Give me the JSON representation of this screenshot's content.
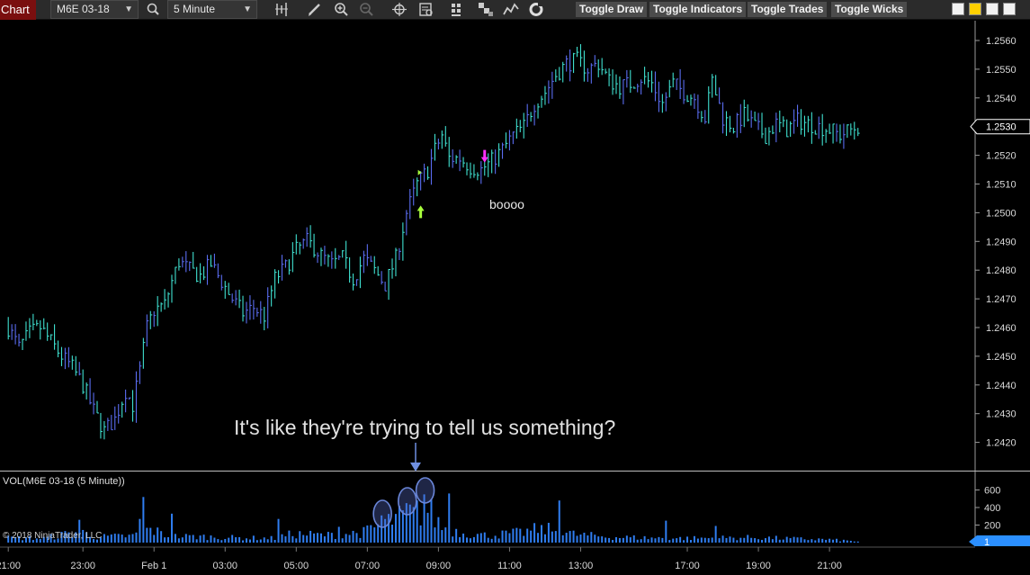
{
  "toolbar": {
    "chart_tab": "Chart",
    "instrument": "M6E 03-18",
    "interval": "5 Minute",
    "buttons": [
      "Toggle Draw",
      "Toggle Indicators",
      "Toggle Trades",
      "Toggle Wicks"
    ],
    "icons": [
      "magnifier-icon",
      "bar-type-icon",
      "pencil-icon",
      "zoom-in-icon",
      "zoom-out-icon",
      "crosshair-icon",
      "data-box-icon",
      "indicators-icon",
      "strategies-icon",
      "templates-icon",
      "refresh-icon"
    ]
  },
  "swatch_colors": [
    "#f2f2f2",
    "#ffd000",
    "#f2f2f2",
    "#f2f2f2"
  ],
  "annotations": {
    "boooo": "boooo",
    "message": "It's like they're trying to tell us something?"
  },
  "volume_panel": {
    "label": "VOL(M6E 03-18 (5 Minute))",
    "current_volume": "1",
    "copyright": "© 2018 NinjaTrader, LLC"
  },
  "colors": {
    "background": "#000000",
    "candle_primary": "#3fe0d0",
    "candle_secondary": "#5a6cf0",
    "volume": "#2f7df0",
    "price_marker": "#ffffff",
    "volume_marker": "#2b8fff",
    "up_arrow": "#a8ff3c",
    "down_arrow": "#ff2fff",
    "annotation_ellipse": "#6a86d8"
  },
  "chart_data": {
    "type": "candlestick",
    "price_axis": {
      "ticks": [
        "1.2420",
        "1.2430",
        "1.2440",
        "1.2450",
        "1.2460",
        "1.2470",
        "1.2480",
        "1.2490",
        "1.2500",
        "1.2510",
        "1.2520",
        "1.2530",
        "1.2540",
        "1.2550",
        "1.2560"
      ],
      "ylim": [
        1.24161,
        1.25631
      ],
      "last_price": "1.2530"
    },
    "volume_axis": {
      "ticks": [
        "200",
        "400",
        "600"
      ],
      "ylim": [
        0,
        800
      ]
    },
    "time_axis": {
      "ticks": [
        "21:00",
        "23:00",
        "Feb 1",
        "03:00",
        "05:00",
        "07:00",
        "09:00",
        "11:00",
        "13:00",
        "17:00",
        "19:00",
        "21:00"
      ],
      "tick_bar_index": [
        0,
        21,
        41,
        61,
        81,
        101,
        121,
        141,
        161,
        191,
        211,
        231
      ]
    },
    "price_path": [
      [
        0,
        1.246
      ],
      [
        3,
        1.2453
      ],
      [
        6,
        1.2458
      ],
      [
        9,
        1.246
      ],
      [
        12,
        1.2455
      ],
      [
        15,
        1.245
      ],
      [
        18,
        1.2446
      ],
      [
        21,
        1.244
      ],
      [
        24,
        1.2431
      ],
      [
        27,
        1.2424
      ],
      [
        30,
        1.2428
      ],
      [
        33,
        1.2438
      ],
      [
        35,
        1.2433
      ],
      [
        37,
        1.2445
      ],
      [
        39,
        1.246
      ],
      [
        41,
        1.2466
      ],
      [
        44,
        1.2468
      ],
      [
        46,
        1.2476
      ],
      [
        48,
        1.2483
      ],
      [
        51,
        1.248
      ],
      [
        54,
        1.2478
      ],
      [
        57,
        1.2482
      ],
      [
        60,
        1.2476
      ],
      [
        63,
        1.247
      ],
      [
        66,
        1.2465
      ],
      [
        69,
        1.2467
      ],
      [
        72,
        1.2464
      ],
      [
        75,
        1.2477
      ],
      [
        78,
        1.2481
      ],
      [
        81,
        1.2487
      ],
      [
        84,
        1.249
      ],
      [
        86,
        1.2488
      ],
      [
        88,
        1.2485
      ],
      [
        91,
        1.2482
      ],
      [
        94,
        1.2484
      ],
      [
        97,
        1.2477
      ],
      [
        100,
        1.2484
      ],
      [
        103,
        1.248
      ],
      [
        106,
        1.2475
      ],
      [
        109,
        1.2484
      ],
      [
        112,
        1.25
      ],
      [
        115,
        1.251
      ],
      [
        118,
        1.2515
      ],
      [
        120,
        1.2522
      ],
      [
        122,
        1.2527
      ],
      [
        124,
        1.2519
      ],
      [
        127,
        1.2519
      ],
      [
        130,
        1.2516
      ],
      [
        133,
        1.2515
      ],
      [
        136,
        1.2518
      ],
      [
        139,
        1.2522
      ],
      [
        142,
        1.2527
      ],
      [
        145,
        1.253
      ],
      [
        148,
        1.2538
      ],
      [
        151,
        1.2542
      ],
      [
        154,
        1.2548
      ],
      [
        157,
        1.2552
      ],
      [
        160,
        1.2553
      ],
      [
        163,
        1.255
      ],
      [
        166,
        1.2552
      ],
      [
        169,
        1.2546
      ],
      [
        172,
        1.2544
      ],
      [
        175,
        1.2545
      ],
      [
        178,
        1.2547
      ],
      [
        181,
        1.2545
      ],
      [
        184,
        1.2538
      ],
      [
        187,
        1.2545
      ],
      [
        190,
        1.2542
      ],
      [
        193,
        1.254
      ],
      [
        196,
        1.2533
      ],
      [
        198,
        1.2546
      ],
      [
        201,
        1.2533
      ],
      [
        204,
        1.253
      ],
      [
        207,
        1.2534
      ],
      [
        210,
        1.253
      ],
      [
        213,
        1.2527
      ],
      [
        216,
        1.2531
      ],
      [
        219,
        1.2529
      ],
      [
        222,
        1.2532
      ],
      [
        225,
        1.2531
      ],
      [
        228,
        1.253
      ],
      [
        231,
        1.2529
      ],
      [
        234,
        1.2527
      ],
      [
        237,
        1.2529
      ],
      [
        239,
        1.253
      ]
    ],
    "volume_profile": [
      [
        0,
        60
      ],
      [
        10,
        55
      ],
      [
        20,
        140
      ],
      [
        25,
        70
      ],
      [
        35,
        85
      ],
      [
        40,
        170
      ],
      [
        45,
        80
      ],
      [
        55,
        75
      ],
      [
        65,
        60
      ],
      [
        75,
        55
      ],
      [
        80,
        110
      ],
      [
        90,
        95
      ],
      [
        100,
        130
      ],
      [
        105,
        230
      ],
      [
        110,
        320
      ],
      [
        115,
        380
      ],
      [
        118,
        420
      ],
      [
        122,
        200
      ],
      [
        128,
        120
      ],
      [
        135,
        90
      ],
      [
        145,
        130
      ],
      [
        150,
        180
      ],
      [
        160,
        100
      ],
      [
        170,
        70
      ],
      [
        180,
        60
      ],
      [
        190,
        55
      ],
      [
        200,
        60
      ],
      [
        210,
        65
      ],
      [
        220,
        50
      ],
      [
        230,
        40
      ],
      [
        239,
        15
      ]
    ],
    "volume_spikes": [
      [
        20,
        260
      ],
      [
        37,
        270
      ],
      [
        38,
        520
      ],
      [
        46,
        330
      ],
      [
        76,
        270
      ],
      [
        93,
        180
      ],
      [
        105,
        310
      ],
      [
        110,
        420
      ],
      [
        112,
        450
      ],
      [
        117,
        550
      ],
      [
        124,
        560
      ],
      [
        155,
        480
      ],
      [
        150,
        200
      ],
      [
        185,
        250
      ],
      [
        199,
        190
      ]
    ],
    "signals": [
      {
        "type": "up-arrow",
        "bar": 116,
        "price": 1.25
      },
      {
        "type": "up-marker",
        "bar": 116,
        "price": 1.2514
      },
      {
        "type": "down-arrow",
        "bar": 134,
        "price": 1.252
      }
    ]
  }
}
